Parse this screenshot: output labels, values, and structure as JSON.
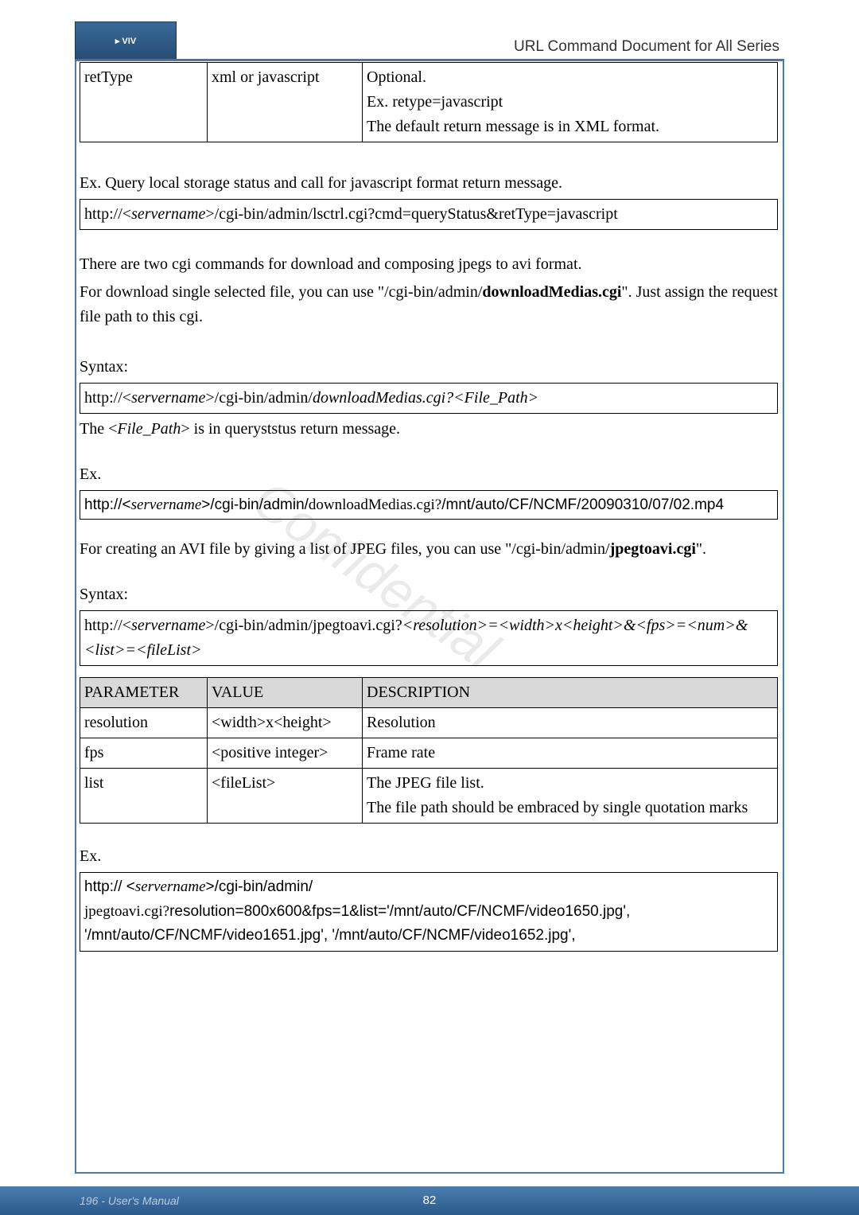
{
  "header": {
    "logo_text": "▸ VIV",
    "title": "URL Command Document for All Series"
  },
  "table1": {
    "r1c1": "retType",
    "r1c2": "xml or javascript",
    "r1c3_l1": "Optional.",
    "r1c3_l2": "Ex. retype=javascript",
    "r1c3_l3": "The default return message is in XML format."
  },
  "para1": "Ex. Query local storage status and call for javascript format return message.",
  "code1": "http://<servername>/cgi-bin/admin/lsctrl.cgi?cmd=queryStatus&retType=javascript",
  "para2": "There are two cgi commands for download and composing jpegs to avi format.",
  "para3_a": "For download single selected file, you can use \"/cgi-bin/admin/",
  "para3_b": "downloadMedias.cgi",
  "para3_c": "\". Just assign the request file path to this cgi.",
  "syntax_label": "Syntax:",
  "code2_a": "http://<",
  "code2_b": "servername",
  "code2_c": ">/cgi-bin/admin/",
  "code2_d": "downloadMedias.cgi?<File_Path>",
  "para4_a": "The <",
  "para4_b": "File_Path",
  "para4_c": "> is in queryststus return message.",
  "ex_label": "Ex.",
  "code3_a": "http://<",
  "code3_b": "servername",
  "code3_c": ">/cgi-bin/admin/",
  "code3_d": "downloadMedias.cgi?/mnt/auto/CF/NCMF/20090310/07/02.mp4",
  "para5_a": "For creating an AVI file by giving a list of JPEG files, you can use \"/cgi-bin/admin/",
  "para5_b": "jpegtoavi.cgi",
  "para5_c": "\".",
  "code4_a": "http://<",
  "code4_b": "servername",
  "code4_c": ">/cgi-bin/admin/jpegtoavi.cgi?",
  "code4_d": "<resolution>=<width>x<height>&<fps>=<num>&<list>=<fileList>",
  "table2": {
    "h1": "PARAMETER",
    "h2": "VALUE",
    "h3": "DESCRIPTION",
    "r1c1": "resolution",
    "r1c2": "<width>x<height>",
    "r1c3": "Resolution",
    "r2c1": "fps",
    "r2c2": "<positive integer>",
    "r2c3": "Frame rate",
    "r3c1": "list",
    "r3c2": "<fileList>",
    "r3c3_l1": "The JPEG file list.",
    "r3c3_l2": "The file path should be embraced by single quotation marks"
  },
  "code5_a": "http:// <",
  "code5_b": "servername",
  "code5_c": ">/cgi-bin/admin/",
  "code5_d": "jpegtoavi.cgi?",
  "code5_e": "resolution=800x600&fps=1&list='/mnt/auto/CF/NCMF/video1650.jpg', '/mnt/auto/CF/NCMF/video1651.jpg', '/mnt/auto/CF/NCMF/video1652.jpg',",
  "footer": {
    "left": "196 - User's Manual",
    "center": "82"
  },
  "watermark": "Confidential"
}
